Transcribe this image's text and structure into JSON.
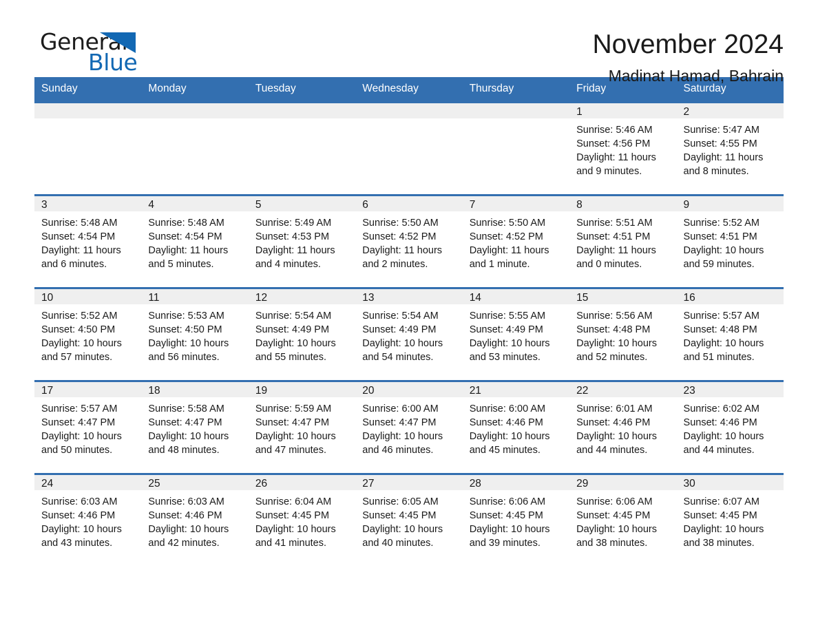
{
  "brand": {
    "name_part1": "General",
    "name_part2": "Blue",
    "accent_color": "#1268b3"
  },
  "header": {
    "month_title": "November 2024",
    "location": "Madinat Hamad, Bahrain"
  },
  "calendar": {
    "header_color": "#336fb0",
    "band_color": "#efefef",
    "weekdays": [
      "Sunday",
      "Monday",
      "Tuesday",
      "Wednesday",
      "Thursday",
      "Friday",
      "Saturday"
    ],
    "weeks": [
      [
        {
          "date": "",
          "empty": true
        },
        {
          "date": "",
          "empty": true
        },
        {
          "date": "",
          "empty": true
        },
        {
          "date": "",
          "empty": true
        },
        {
          "date": "",
          "empty": true
        },
        {
          "date": "1",
          "sunrise": "Sunrise: 5:46 AM",
          "sunset": "Sunset: 4:56 PM",
          "daylight": "Daylight: 11 hours and 9 minutes."
        },
        {
          "date": "2",
          "sunrise": "Sunrise: 5:47 AM",
          "sunset": "Sunset: 4:55 PM",
          "daylight": "Daylight: 11 hours and 8 minutes."
        }
      ],
      [
        {
          "date": "3",
          "sunrise": "Sunrise: 5:48 AM",
          "sunset": "Sunset: 4:54 PM",
          "daylight": "Daylight: 11 hours and 6 minutes."
        },
        {
          "date": "4",
          "sunrise": "Sunrise: 5:48 AM",
          "sunset": "Sunset: 4:54 PM",
          "daylight": "Daylight: 11 hours and 5 minutes."
        },
        {
          "date": "5",
          "sunrise": "Sunrise: 5:49 AM",
          "sunset": "Sunset: 4:53 PM",
          "daylight": "Daylight: 11 hours and 4 minutes."
        },
        {
          "date": "6",
          "sunrise": "Sunrise: 5:50 AM",
          "sunset": "Sunset: 4:52 PM",
          "daylight": "Daylight: 11 hours and 2 minutes."
        },
        {
          "date": "7",
          "sunrise": "Sunrise: 5:50 AM",
          "sunset": "Sunset: 4:52 PM",
          "daylight": "Daylight: 11 hours and 1 minute."
        },
        {
          "date": "8",
          "sunrise": "Sunrise: 5:51 AM",
          "sunset": "Sunset: 4:51 PM",
          "daylight": "Daylight: 11 hours and 0 minutes."
        },
        {
          "date": "9",
          "sunrise": "Sunrise: 5:52 AM",
          "sunset": "Sunset: 4:51 PM",
          "daylight": "Daylight: 10 hours and 59 minutes."
        }
      ],
      [
        {
          "date": "10",
          "sunrise": "Sunrise: 5:52 AM",
          "sunset": "Sunset: 4:50 PM",
          "daylight": "Daylight: 10 hours and 57 minutes."
        },
        {
          "date": "11",
          "sunrise": "Sunrise: 5:53 AM",
          "sunset": "Sunset: 4:50 PM",
          "daylight": "Daylight: 10 hours and 56 minutes."
        },
        {
          "date": "12",
          "sunrise": "Sunrise: 5:54 AM",
          "sunset": "Sunset: 4:49 PM",
          "daylight": "Daylight: 10 hours and 55 minutes."
        },
        {
          "date": "13",
          "sunrise": "Sunrise: 5:54 AM",
          "sunset": "Sunset: 4:49 PM",
          "daylight": "Daylight: 10 hours and 54 minutes."
        },
        {
          "date": "14",
          "sunrise": "Sunrise: 5:55 AM",
          "sunset": "Sunset: 4:49 PM",
          "daylight": "Daylight: 10 hours and 53 minutes."
        },
        {
          "date": "15",
          "sunrise": "Sunrise: 5:56 AM",
          "sunset": "Sunset: 4:48 PM",
          "daylight": "Daylight: 10 hours and 52 minutes."
        },
        {
          "date": "16",
          "sunrise": "Sunrise: 5:57 AM",
          "sunset": "Sunset: 4:48 PM",
          "daylight": "Daylight: 10 hours and 51 minutes."
        }
      ],
      [
        {
          "date": "17",
          "sunrise": "Sunrise: 5:57 AM",
          "sunset": "Sunset: 4:47 PM",
          "daylight": "Daylight: 10 hours and 50 minutes."
        },
        {
          "date": "18",
          "sunrise": "Sunrise: 5:58 AM",
          "sunset": "Sunset: 4:47 PM",
          "daylight": "Daylight: 10 hours and 48 minutes."
        },
        {
          "date": "19",
          "sunrise": "Sunrise: 5:59 AM",
          "sunset": "Sunset: 4:47 PM",
          "daylight": "Daylight: 10 hours and 47 minutes."
        },
        {
          "date": "20",
          "sunrise": "Sunrise: 6:00 AM",
          "sunset": "Sunset: 4:47 PM",
          "daylight": "Daylight: 10 hours and 46 minutes."
        },
        {
          "date": "21",
          "sunrise": "Sunrise: 6:00 AM",
          "sunset": "Sunset: 4:46 PM",
          "daylight": "Daylight: 10 hours and 45 minutes."
        },
        {
          "date": "22",
          "sunrise": "Sunrise: 6:01 AM",
          "sunset": "Sunset: 4:46 PM",
          "daylight": "Daylight: 10 hours and 44 minutes."
        },
        {
          "date": "23",
          "sunrise": "Sunrise: 6:02 AM",
          "sunset": "Sunset: 4:46 PM",
          "daylight": "Daylight: 10 hours and 44 minutes."
        }
      ],
      [
        {
          "date": "24",
          "sunrise": "Sunrise: 6:03 AM",
          "sunset": "Sunset: 4:46 PM",
          "daylight": "Daylight: 10 hours and 43 minutes."
        },
        {
          "date": "25",
          "sunrise": "Sunrise: 6:03 AM",
          "sunset": "Sunset: 4:46 PM",
          "daylight": "Daylight: 10 hours and 42 minutes."
        },
        {
          "date": "26",
          "sunrise": "Sunrise: 6:04 AM",
          "sunset": "Sunset: 4:45 PM",
          "daylight": "Daylight: 10 hours and 41 minutes."
        },
        {
          "date": "27",
          "sunrise": "Sunrise: 6:05 AM",
          "sunset": "Sunset: 4:45 PM",
          "daylight": "Daylight: 10 hours and 40 minutes."
        },
        {
          "date": "28",
          "sunrise": "Sunrise: 6:06 AM",
          "sunset": "Sunset: 4:45 PM",
          "daylight": "Daylight: 10 hours and 39 minutes."
        },
        {
          "date": "29",
          "sunrise": "Sunrise: 6:06 AM",
          "sunset": "Sunset: 4:45 PM",
          "daylight": "Daylight: 10 hours and 38 minutes."
        },
        {
          "date": "30",
          "sunrise": "Sunrise: 6:07 AM",
          "sunset": "Sunset: 4:45 PM",
          "daylight": "Daylight: 10 hours and 38 minutes."
        }
      ]
    ]
  }
}
